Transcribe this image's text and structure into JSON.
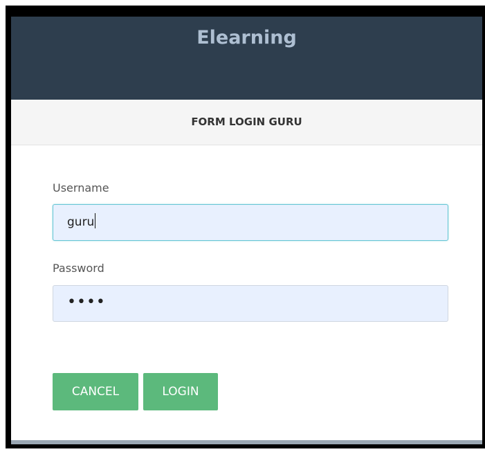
{
  "app": {
    "title": "Elearning"
  },
  "form": {
    "header": "FORM LOGIN GURU",
    "username": {
      "label": "Username",
      "value": "guru"
    },
    "password": {
      "label": "Password",
      "masked_value": "••••"
    }
  },
  "buttons": {
    "cancel": "CANCEL",
    "login": "LOGIN"
  },
  "colors": {
    "header_bg": "#2e3e4e",
    "title_text": "#aebfd2",
    "input_bg": "#e8f0fe",
    "focus_border": "#66c6d4",
    "button_bg": "#5cb97c"
  }
}
